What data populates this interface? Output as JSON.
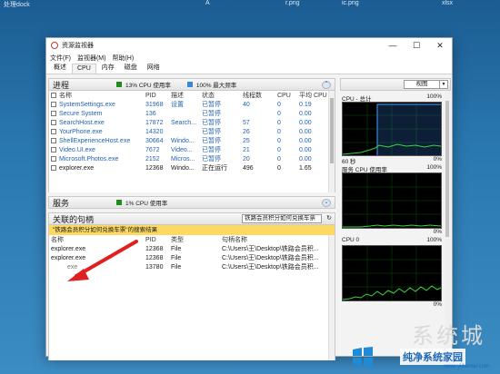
{
  "desktop": {
    "top_items": [
      "处理dock",
      "A",
      "r.png",
      "ic.png",
      "xlsx"
    ],
    "watermark_text": "系统城",
    "watermark_brand": "纯净系统家园",
    "watermark_url": "www.yidaimei.com"
  },
  "window": {
    "title": "资源监视器",
    "controls": {
      "minimize": "—",
      "maximize": "☐",
      "close": "✕"
    }
  },
  "menu": [
    "文件(F)",
    "监视器(M)",
    "帮助(H)"
  ],
  "tabs": [
    "概述",
    "CPU",
    "内存",
    "磁盘",
    "网络"
  ],
  "processes": {
    "title": "进程",
    "stat1": "13% CPU 使用率",
    "stat1_color": "#1e8c1e",
    "stat2": "100% 最大频率",
    "stat2_color": "#3a87d6",
    "columns": [
      "名称",
      "PID",
      "描述",
      "状态",
      "线程数",
      "CPU",
      "平均 CPU"
    ],
    "rows": [
      [
        "SystemSettings.exe",
        "31968",
        "设置",
        "已暂停",
        "40",
        "0",
        "0.19"
      ],
      [
        "Secure System",
        "136",
        "",
        "已暂停",
        "",
        "0",
        "0.00"
      ],
      [
        "SearchHost.exe",
        "17872",
        "Search...",
        "已暂停",
        "57",
        "0",
        "0.00"
      ],
      [
        "YourPhone.exe",
        "14320",
        "",
        "已暂停",
        "26",
        "0",
        "0.00"
      ],
      [
        "ShellExperienceHost.exe",
        "30664",
        "Windo...",
        "已暂停",
        "25",
        "0",
        "0.00"
      ],
      [
        "Video.UI.exe",
        "7672",
        "Video...",
        "已暂停",
        "21",
        "0",
        "0.00"
      ],
      [
        "Microsoft.Photos.exe",
        "2152",
        "Micros...",
        "已暂停",
        "20",
        "0",
        "0.00"
      ],
      [
        "explorer.exe",
        "12368",
        "Windo...",
        "正在运行",
        "496",
        "0",
        "1.65"
      ]
    ]
  },
  "services": {
    "title": "服务",
    "stat": "1% CPU 使用率",
    "stat_color": "#1e8c1e"
  },
  "handles": {
    "title": "关联的句柄",
    "search_value": "铁路会员积分如何兑换车票",
    "search_button": "↻",
    "result_text": "\"铁路会员积分如何兑换车票\"的搜索结果",
    "columns": [
      "名称",
      "PID",
      "类型",
      "句柄名称"
    ],
    "rows": [
      [
        "explorer.exe",
        "12368",
        "File",
        "C:\\Users\\王\\Desktop\\铁路会员积..."
      ],
      [
        "explorer.exe",
        "12368",
        "File",
        "C:\\Users\\王\\Desktop\\铁路会员积..."
      ],
      [
        "exe",
        "13780",
        "File",
        "C:\\Users\\王\\Desktop\\铁路会员积..."
      ]
    ]
  },
  "graphs": {
    "view_label": "视图",
    "cpu_total": {
      "label": "CPU - 总计",
      "max": "100%",
      "footer_left": "60 秒",
      "footer_right": "0%"
    },
    "service_cpu": {
      "label": "服务 CPU 使用率",
      "max": "100%",
      "footer_right": "0%"
    },
    "cpu0": {
      "label": "CPU 0",
      "max": "100%",
      "footer_right": "0%"
    }
  }
}
